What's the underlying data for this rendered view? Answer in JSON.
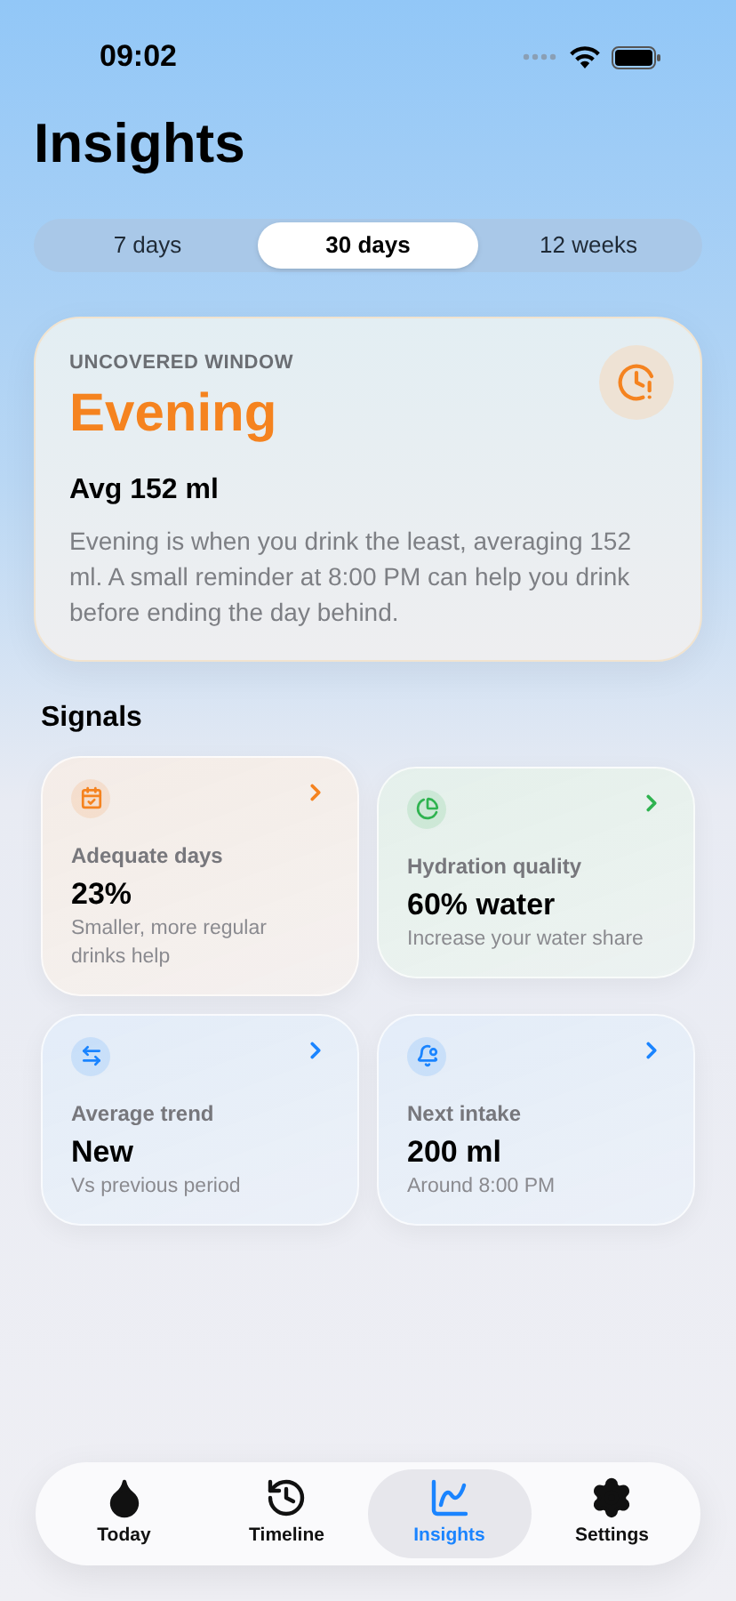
{
  "status_bar": {
    "time": "09:02"
  },
  "title": "Insights",
  "periods": [
    {
      "label": "7 days",
      "selected": false
    },
    {
      "label": "30 days",
      "selected": true
    },
    {
      "label": "12 weeks",
      "selected": false
    }
  ],
  "highlight": {
    "eyebrow": "UNCOVERED WINDOW",
    "headline": "Evening",
    "stat": "Avg 152 ml",
    "body": "Evening is when you drink the least, averaging 152 ml. A small reminder at 8:00 PM can help you drink before ending the day behind."
  },
  "signals_heading": "Signals",
  "signals": [
    {
      "kind": "calendar",
      "color": "#f5831f",
      "label": "Adequate days",
      "value": "23%",
      "note": "Smaller, more regular drinks help"
    },
    {
      "kind": "pie",
      "color": "#2fb350",
      "label": "Hydration quality",
      "value": "60% water",
      "note": "Increase your water share"
    },
    {
      "kind": "trend",
      "color": "#1a84ff",
      "label": "Average trend",
      "value": "New",
      "note": "Vs previous period"
    },
    {
      "kind": "bell",
      "color": "#1a84ff",
      "label": "Next intake",
      "value": "200 ml",
      "note": "Around 8:00 PM"
    }
  ],
  "tab_bar": [
    {
      "kind": "today",
      "label": "Today",
      "selected": false
    },
    {
      "kind": "timeline",
      "label": "Timeline",
      "selected": false
    },
    {
      "kind": "insights",
      "label": "Insights",
      "selected": true
    },
    {
      "kind": "settings",
      "label": "Settings",
      "selected": false
    }
  ]
}
